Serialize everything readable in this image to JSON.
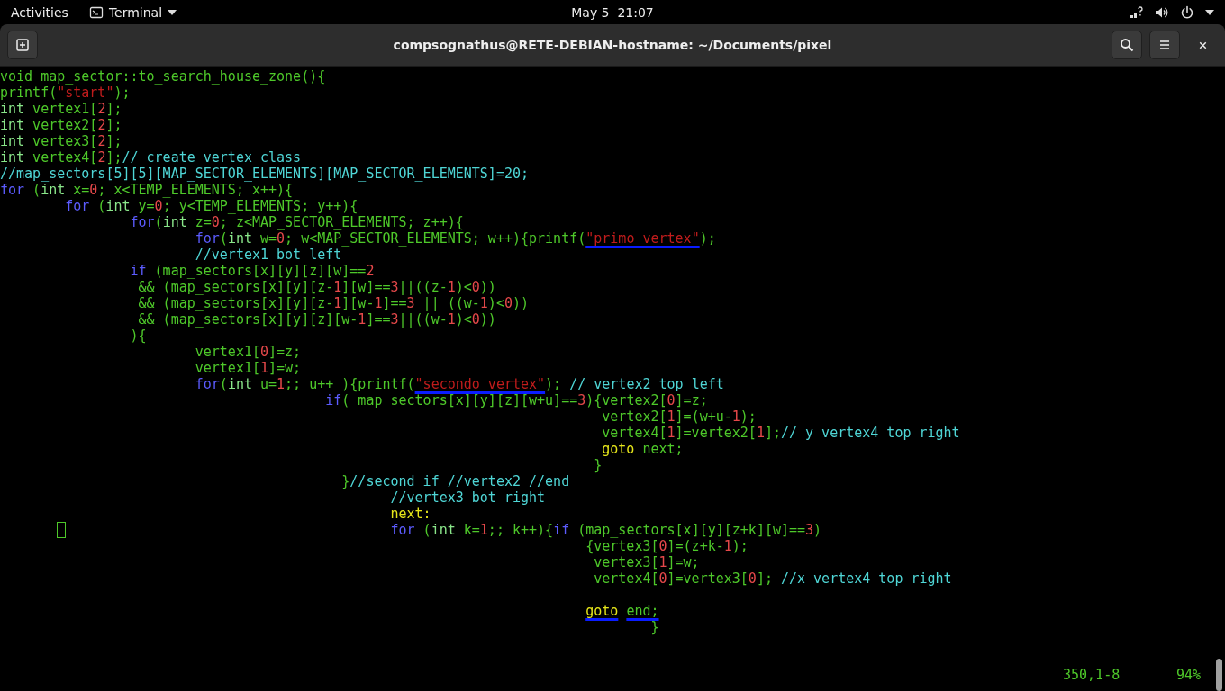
{
  "top_bar": {
    "activities": "Activities",
    "app_menu": "Terminal",
    "clock": "May 5  21:07"
  },
  "window": {
    "title": "compsognathus@RETE-DEBIAN-hostname: ~/Documents/pixel"
  },
  "editor": {
    "lines": [
      {
        "kind": "code",
        "tokens": [
          {
            "kind": "plain",
            "text": "void map_sector::to_search_house_zone(){"
          }
        ]
      },
      {
        "kind": "code",
        "tokens": [
          {
            "kind": "plain",
            "text": "printf("
          },
          {
            "kind": "string",
            "text": "\"start\""
          },
          {
            "kind": "plain",
            "text": ");"
          }
        ]
      },
      {
        "kind": "code",
        "tokens": [
          {
            "kind": "type",
            "text": "int"
          },
          {
            "kind": "plain",
            "text": " vertex1["
          },
          {
            "kind": "number",
            "text": "2"
          },
          {
            "kind": "plain",
            "text": "];"
          }
        ]
      },
      {
        "kind": "code",
        "tokens": [
          {
            "kind": "type",
            "text": "int"
          },
          {
            "kind": "plain",
            "text": " vertex2["
          },
          {
            "kind": "number",
            "text": "2"
          },
          {
            "kind": "plain",
            "text": "];"
          }
        ]
      },
      {
        "kind": "code",
        "tokens": [
          {
            "kind": "type",
            "text": "int"
          },
          {
            "kind": "plain",
            "text": " vertex3["
          },
          {
            "kind": "number",
            "text": "2"
          },
          {
            "kind": "plain",
            "text": "];"
          }
        ]
      },
      {
        "kind": "code",
        "tokens": [
          {
            "kind": "type",
            "text": "int"
          },
          {
            "kind": "plain",
            "text": " vertex4["
          },
          {
            "kind": "number",
            "text": "2"
          },
          {
            "kind": "plain",
            "text": "];"
          },
          {
            "kind": "comment",
            "text": "// create vertex class"
          }
        ]
      },
      {
        "kind": "code",
        "tokens": [
          {
            "kind": "comment",
            "text": "//map_sectors[5][5][MAP_SECTOR_ELEMENTS][MAP_SECTOR_ELEMENTS]=20;"
          }
        ]
      },
      {
        "kind": "code",
        "tokens": [
          {
            "kind": "keyword",
            "text": "for"
          },
          {
            "kind": "plain",
            "text": " ("
          },
          {
            "kind": "type",
            "text": "int"
          },
          {
            "kind": "plain",
            "text": " x="
          },
          {
            "kind": "number",
            "text": "0"
          },
          {
            "kind": "plain",
            "text": "; x<TEMP_ELEMENTS; x++){"
          }
        ]
      },
      {
        "kind": "code",
        "tokens": [
          {
            "kind": "keyword",
            "text": "        for"
          },
          {
            "kind": "plain",
            "text": " ("
          },
          {
            "kind": "type",
            "text": "int"
          },
          {
            "kind": "plain",
            "text": " y="
          },
          {
            "kind": "number",
            "text": "0"
          },
          {
            "kind": "plain",
            "text": "; y<TEMP_ELEMENTS; y++){"
          }
        ]
      },
      {
        "kind": "code",
        "tokens": [
          {
            "kind": "keyword",
            "text": "                for"
          },
          {
            "kind": "plain",
            "text": "("
          },
          {
            "kind": "type",
            "text": "int"
          },
          {
            "kind": "plain",
            "text": " z="
          },
          {
            "kind": "number",
            "text": "0"
          },
          {
            "kind": "plain",
            "text": "; z<MAP_SECTOR_ELEMENTS; z++){"
          }
        ]
      },
      {
        "kind": "code",
        "tokens": [
          {
            "kind": "keyword",
            "text": "                        for"
          },
          {
            "kind": "plain",
            "text": "("
          },
          {
            "kind": "type",
            "text": "int"
          },
          {
            "kind": "plain",
            "text": " w="
          },
          {
            "kind": "number",
            "text": "0"
          },
          {
            "kind": "plain",
            "text": "; w<MAP_SECTOR_ELEMENTS; w++){printf("
          },
          {
            "kind": "string",
            "text": "\"primo vertex\"",
            "redacted": true
          },
          {
            "kind": "plain",
            "text": ");"
          }
        ]
      },
      {
        "kind": "code",
        "tokens": [
          {
            "kind": "comment",
            "text": "                        //vertex1 bot left"
          }
        ]
      },
      {
        "kind": "code",
        "tokens": [
          {
            "kind": "keyword",
            "text": "                if"
          },
          {
            "kind": "plain",
            "text": " (map_sectors[x][y][z][w]=="
          },
          {
            "kind": "number",
            "text": "2"
          }
        ]
      },
      {
        "kind": "code",
        "tokens": [
          {
            "kind": "plain",
            "text": "                 && (map_sectors[x][y][z-"
          },
          {
            "kind": "number",
            "text": "1"
          },
          {
            "kind": "plain",
            "text": "][w]=="
          },
          {
            "kind": "number",
            "text": "3"
          },
          {
            "kind": "plain",
            "text": "||((z-"
          },
          {
            "kind": "number",
            "text": "1"
          },
          {
            "kind": "plain",
            "text": ")<"
          },
          {
            "kind": "number",
            "text": "0"
          },
          {
            "kind": "plain",
            "text": "))"
          }
        ]
      },
      {
        "kind": "code",
        "tokens": [
          {
            "kind": "plain",
            "text": "                 && (map_sectors[x][y][z-"
          },
          {
            "kind": "number",
            "text": "1"
          },
          {
            "kind": "plain",
            "text": "][w-"
          },
          {
            "kind": "number",
            "text": "1"
          },
          {
            "kind": "plain",
            "text": "]=="
          },
          {
            "kind": "number",
            "text": "3"
          },
          {
            "kind": "plain",
            "text": " || ((w-"
          },
          {
            "kind": "number",
            "text": "1"
          },
          {
            "kind": "plain",
            "text": ")<"
          },
          {
            "kind": "number",
            "text": "0"
          },
          {
            "kind": "plain",
            "text": "))"
          }
        ]
      },
      {
        "kind": "code",
        "tokens": [
          {
            "kind": "plain",
            "text": "                 && (map_sectors[x][y][z][w-"
          },
          {
            "kind": "number",
            "text": "1"
          },
          {
            "kind": "plain",
            "text": "]=="
          },
          {
            "kind": "number",
            "text": "3"
          },
          {
            "kind": "plain",
            "text": "||((w-"
          },
          {
            "kind": "number",
            "text": "1"
          },
          {
            "kind": "plain",
            "text": ")<"
          },
          {
            "kind": "number",
            "text": "0"
          },
          {
            "kind": "plain",
            "text": "))"
          }
        ]
      },
      {
        "kind": "code",
        "tokens": [
          {
            "kind": "plain",
            "text": "                ){"
          }
        ]
      },
      {
        "kind": "code",
        "tokens": [
          {
            "kind": "plain",
            "text": "                        vertex1["
          },
          {
            "kind": "number",
            "text": "0"
          },
          {
            "kind": "plain",
            "text": "]=z;"
          }
        ]
      },
      {
        "kind": "code",
        "tokens": [
          {
            "kind": "plain",
            "text": "                        vertex1["
          },
          {
            "kind": "number",
            "text": "1"
          },
          {
            "kind": "plain",
            "text": "]=w;"
          }
        ]
      },
      {
        "kind": "code",
        "tokens": [
          {
            "kind": "keyword",
            "text": "                        for"
          },
          {
            "kind": "plain",
            "text": "("
          },
          {
            "kind": "type",
            "text": "int"
          },
          {
            "kind": "plain",
            "text": " u="
          },
          {
            "kind": "number",
            "text": "1"
          },
          {
            "kind": "plain",
            "text": ";; u++ ){printf("
          },
          {
            "kind": "string",
            "text": "\"secondo vertex\"",
            "redacted": true
          },
          {
            "kind": "plain",
            "text": ");"
          },
          {
            "kind": "comment",
            "text": " // vertex2 top left"
          }
        ]
      },
      {
        "kind": "code",
        "tokens": [
          {
            "kind": "keyword",
            "text": "                                        if"
          },
          {
            "kind": "plain",
            "text": "( map_sectors[x][y][z][w+u]=="
          },
          {
            "kind": "number",
            "text": "3"
          },
          {
            "kind": "plain",
            "text": "){vertex2["
          },
          {
            "kind": "number",
            "text": "0"
          },
          {
            "kind": "plain",
            "text": "]=z;"
          }
        ]
      },
      {
        "kind": "code",
        "tokens": [
          {
            "kind": "plain",
            "text": "                                                                          vertex2["
          },
          {
            "kind": "number",
            "text": "1"
          },
          {
            "kind": "plain",
            "text": "]=(w+u-"
          },
          {
            "kind": "number",
            "text": "1"
          },
          {
            "kind": "plain",
            "text": ");"
          }
        ]
      },
      {
        "kind": "code",
        "tokens": [
          {
            "kind": "plain",
            "text": "                                                                          vertex4["
          },
          {
            "kind": "number",
            "text": "1"
          },
          {
            "kind": "plain",
            "text": "]=vertex2["
          },
          {
            "kind": "number",
            "text": "1"
          },
          {
            "kind": "plain",
            "text": "];"
          },
          {
            "kind": "comment",
            "text": "// y vertex4 top right"
          }
        ]
      },
      {
        "kind": "code",
        "tokens": [
          {
            "kind": "label",
            "text": "                                                                          goto"
          },
          {
            "kind": "plain",
            "text": " next;"
          }
        ]
      },
      {
        "kind": "code",
        "tokens": [
          {
            "kind": "plain",
            "text": "                                                                         }"
          }
        ]
      },
      {
        "kind": "code",
        "tokens": [
          {
            "kind": "plain",
            "text": "                                          }"
          },
          {
            "kind": "comment",
            "text": "//second if //vertex2 //end"
          }
        ]
      },
      {
        "kind": "code",
        "tokens": [
          {
            "kind": "comment",
            "text": "                                                //vertex3 bot right"
          }
        ]
      },
      {
        "kind": "code",
        "tokens": [
          {
            "kind": "label",
            "text": "                                                next:"
          }
        ]
      },
      {
        "kind": "code",
        "tokens": [
          {
            "kind": "cursor"
          },
          {
            "kind": "keyword",
            "text": "                                                for"
          },
          {
            "kind": "plain",
            "text": " ("
          },
          {
            "kind": "type",
            "text": "int"
          },
          {
            "kind": "plain",
            "text": " k="
          },
          {
            "kind": "number",
            "text": "1"
          },
          {
            "kind": "plain",
            "text": ";; k++){"
          },
          {
            "kind": "keyword",
            "text": "if"
          },
          {
            "kind": "plain",
            "text": " (map_sectors[x][y][z+k][w]=="
          },
          {
            "kind": "number",
            "text": "3"
          },
          {
            "kind": "plain",
            "text": ")"
          }
        ]
      },
      {
        "kind": "code",
        "tokens": [
          {
            "kind": "plain",
            "text": "                                                                        {vertex3["
          },
          {
            "kind": "number",
            "text": "0"
          },
          {
            "kind": "plain",
            "text": "]=(z+k-"
          },
          {
            "kind": "number",
            "text": "1"
          },
          {
            "kind": "plain",
            "text": ");"
          }
        ]
      },
      {
        "kind": "code",
        "tokens": [
          {
            "kind": "plain",
            "text": "                                                                         vertex3["
          },
          {
            "kind": "number",
            "text": "1"
          },
          {
            "kind": "plain",
            "text": "]=w;"
          }
        ]
      },
      {
        "kind": "code",
        "tokens": [
          {
            "kind": "plain",
            "text": "                                                                         vertex4["
          },
          {
            "kind": "number",
            "text": "0"
          },
          {
            "kind": "plain",
            "text": "]=vertex3["
          },
          {
            "kind": "number",
            "text": "0"
          },
          {
            "kind": "plain",
            "text": "];"
          },
          {
            "kind": "comment",
            "text": " //x vertex4 top right"
          }
        ]
      },
      {
        "kind": "blank"
      },
      {
        "kind": "code",
        "tokens": [
          {
            "kind": "label",
            "text": "                                                                        goto",
            "redacted": true
          },
          {
            "kind": "plain",
            "text": " end;",
            "redacted": true
          }
        ]
      },
      {
        "kind": "code",
        "tokens": [
          {
            "kind": "plain",
            "text": "                                                                                }"
          }
        ]
      }
    ],
    "status_line": {
      "position": "350,1-8",
      "scroll": "94%"
    }
  }
}
